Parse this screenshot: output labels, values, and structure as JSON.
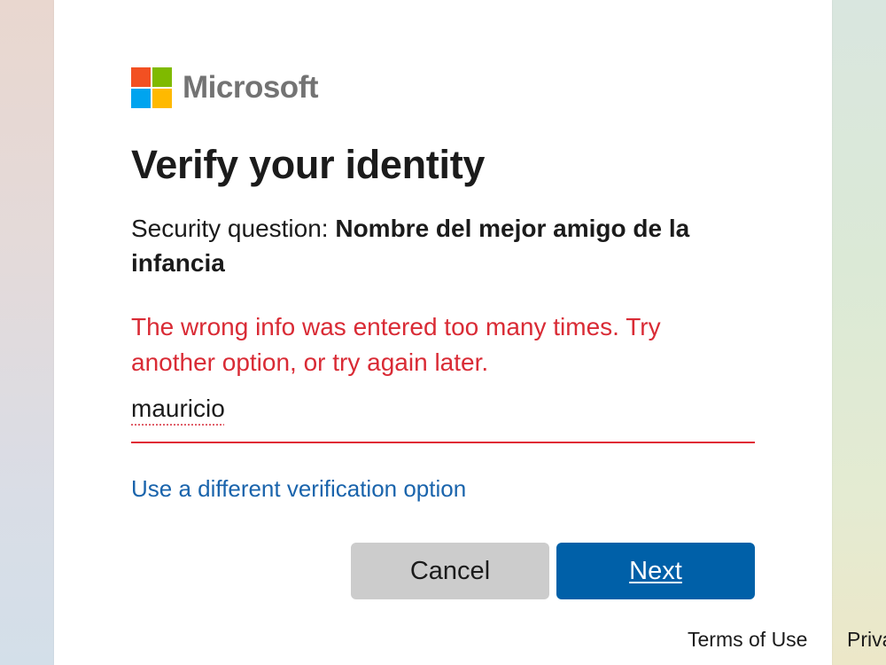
{
  "logo": {
    "wordmark": "Microsoft",
    "colors": [
      "#f25022",
      "#7fba00",
      "#00a4ef",
      "#ffb900"
    ]
  },
  "title": "Verify your identity",
  "question": {
    "prefix": "Security question: ",
    "text": "Nombre del mejor amigo de la infancia"
  },
  "error": "The wrong info was entered too many times. Try another option, or try again later.",
  "answer": {
    "value": "mauricio"
  },
  "alt_link": "Use a different verification option",
  "buttons": {
    "cancel": "Cancel",
    "next": "Next"
  },
  "footer": {
    "terms": "Terms of Use",
    "privacy": "Priva"
  },
  "colors": {
    "error": "#d92b35",
    "link": "#1a64ac",
    "primary": "#0060a8"
  }
}
